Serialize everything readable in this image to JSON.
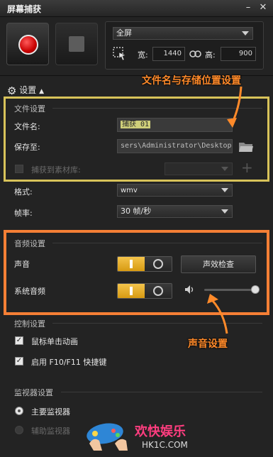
{
  "window": {
    "title": "屏幕捕获",
    "minimize": "–",
    "close": "✕"
  },
  "region": {
    "mode": "全屏",
    "width_label": "宽:",
    "width_value": "1440",
    "height_label": "高:",
    "height_value": "900"
  },
  "settings": {
    "label": "设置",
    "caret": "▲"
  },
  "file_settings": {
    "title": "文件设置",
    "filename_label": "文件名:",
    "filename_value": "捕获 01",
    "saveto_label": "保存至:",
    "saveto_value": "sers\\Administrator\\Desktop",
    "library_label": "捕获到素材库:",
    "format_label": "格式:",
    "format_value": "wmv",
    "framerate_label": "帧率:",
    "framerate_value": "30 帧/秒"
  },
  "audio_settings": {
    "title": "音频设置",
    "voice_label": "声音",
    "check_button": "声效检查",
    "system_audio_label": "系统音频",
    "volume_level": 1.0
  },
  "control_settings": {
    "title": "控制设置",
    "mouse_anim_label": "鼠标单击动画",
    "hotkeys_label": "启用 F10/F11 快捷键"
  },
  "monitor_settings": {
    "title": "监视器设置",
    "primary_label": "主要监视器",
    "secondary_label": "辅助监视器"
  },
  "annotations": {
    "file_note": "文件名与存储位置设置",
    "audio_note": "声音设置",
    "highlight_file_color": "#d8c35a",
    "highlight_audio_color": "#f57f35"
  },
  "watermark": {
    "brand": "欢快娱乐",
    "site": "HK1C.COM"
  }
}
